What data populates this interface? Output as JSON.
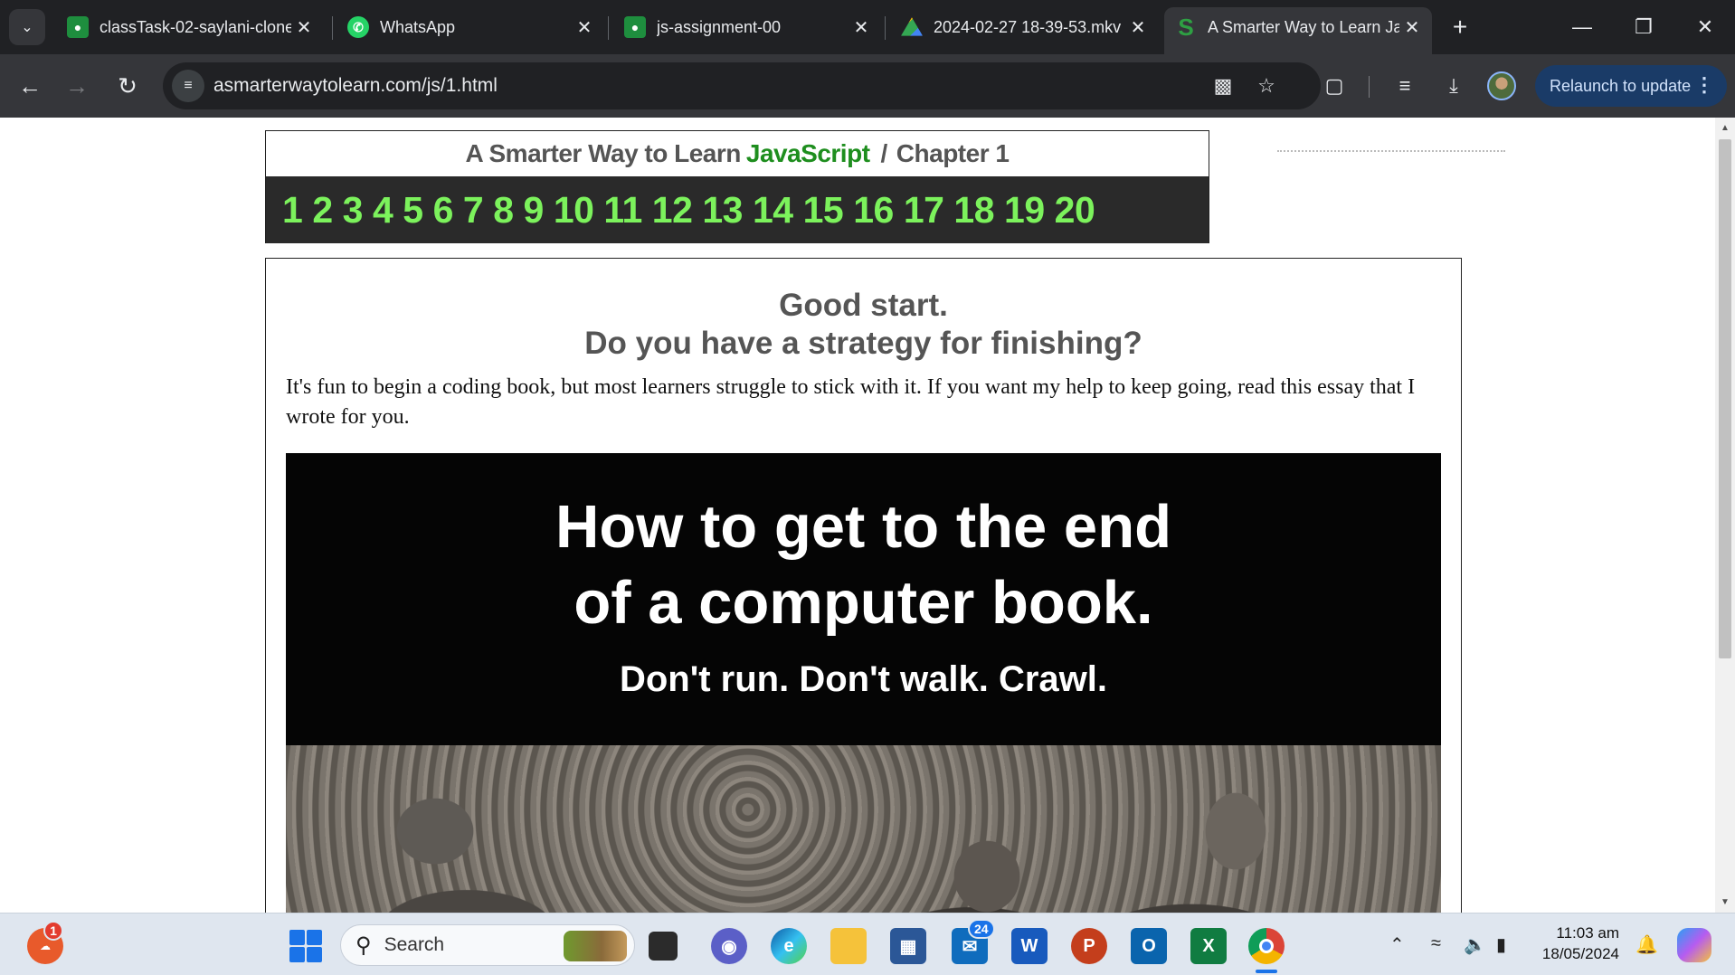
{
  "browser": {
    "tabs": [
      {
        "label": "classTask-02-saylani-clone",
        "icon": "classroom-icon",
        "active": false
      },
      {
        "label": "WhatsApp",
        "icon": "whatsapp-icon",
        "active": false
      },
      {
        "label": "js-assignment-00",
        "icon": "classroom-icon",
        "active": false
      },
      {
        "label": "2024-02-27 18-39-53.mkv",
        "icon": "google-drive-icon",
        "active": false
      },
      {
        "label": "A Smarter Way to Learn JavaScript",
        "icon": "smarter-way-icon",
        "active": true
      }
    ],
    "url": "asmarterwaytolearn.com/js/1.html",
    "relaunch_label": "Relaunch to update"
  },
  "page": {
    "header": {
      "brand_prefix": "A Smarter Way to Learn",
      "brand_highlight": "JavaScript",
      "separator": "/",
      "chapter": "Chapter 1"
    },
    "chapters": [
      "1",
      "2",
      "3",
      "4",
      "5",
      "6",
      "7",
      "8",
      "9",
      "10",
      "11",
      "12",
      "13",
      "14",
      "15",
      "16",
      "17",
      "18",
      "19",
      "20"
    ],
    "headline_1": "Good start.",
    "headline_2": "Do you have a strategy for finishing?",
    "intro": "It's fun to begin a coding book, but most learners struggle to stick with it. If you want my help to keep going, read this essay that I wrote for you.",
    "promo": {
      "title_line_1": "How to get to the end",
      "title_line_2": "of a computer book.",
      "subtitle": "Don't run. Don't walk. Crawl."
    }
  },
  "taskbar": {
    "weather_badge": "1",
    "search_placeholder": "Search",
    "mail_badge": "24",
    "time": "11:03 am",
    "date": "18/05/2024"
  },
  "colors": {
    "chrome_dark": "#202124",
    "chrome_toolbar": "#35363a",
    "js_green": "#1e8e1e",
    "chapter_green": "#7cf25c",
    "taskbar": "#dfe6ef"
  }
}
